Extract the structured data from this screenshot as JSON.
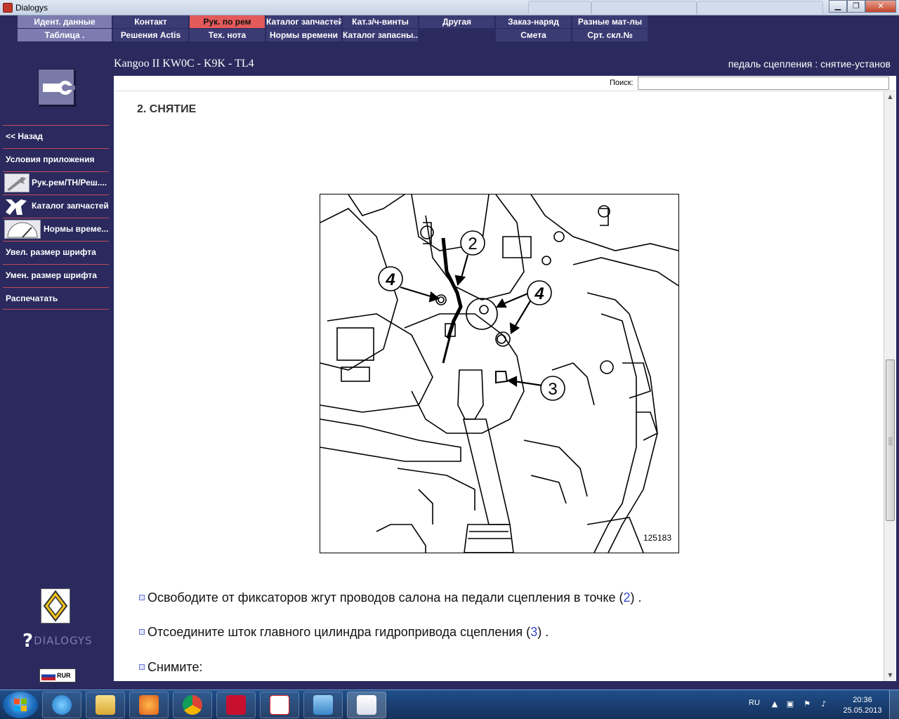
{
  "window": {
    "title": "Dialogys"
  },
  "menu": {
    "row1": [
      "Идент. данные",
      "Контакт",
      "Рук. по рем",
      "Каталог запчастей",
      "Кат.з/ч-винты",
      "Другая",
      "Заказ-наряд",
      "Разные мат-лы"
    ],
    "row2": [
      "Таблица .",
      "Решения Actis",
      "Тех. нота",
      "Нормы времени",
      "Каталог запасны...",
      "Смета",
      "Срт. скл.№"
    ]
  },
  "header": {
    "vehicle": "Kangoo II KW0C - K9K - TL4",
    "operation": "педаль сцепления : снятие-установ"
  },
  "sidebar": {
    "items": [
      "<< Назад",
      "Условия приложения",
      "Рук.рем/ТН/Реш....",
      "Каталог запчастей",
      "Нормы време...",
      "Увел. размер шрифта",
      "Умен. размер шрифта",
      "Распечатать"
    ],
    "logo_text": "DIALOGYS",
    "lang": "RUR"
  },
  "search": {
    "label": "Поиск:",
    "value": ""
  },
  "doc": {
    "section_title": "2. СНЯТИЕ",
    "figure_number": "125183",
    "callouts": [
      "2",
      "4",
      "4",
      "3"
    ],
    "steps": [
      {
        "text": "Освободите от фиксаторов жгут проводов салона на педали сцепления в точке (",
        "ref": "2",
        "tail": ") ."
      },
      {
        "text": "Отсоедините шток главного цилиндра гидропривода сцепления (",
        "ref": "3",
        "tail": ") ."
      },
      {
        "text": "Снимите:",
        "ref": "",
        "tail": ""
      }
    ]
  },
  "taskbar": {
    "lang": "RU",
    "time": "20:36",
    "date": "25.05.2013"
  },
  "colors": {
    "bg": "#2a2a5e",
    "menu_dark": "#3b3b74",
    "menu_light": "#7c7cb0",
    "menu_active": "#e35a5a",
    "separator": "#c44b5a"
  }
}
